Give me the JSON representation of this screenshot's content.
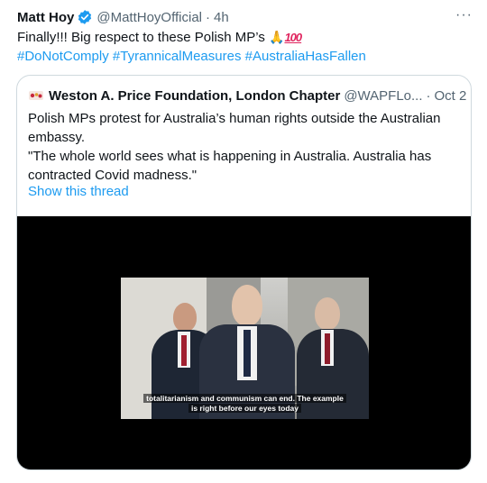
{
  "tweet": {
    "author_name": "Matt Hoy",
    "handle": "@MattHoyOfficial",
    "separator": "·",
    "time": "4h",
    "more": "···",
    "text": "Finally!!! Big respect to these Polish MP’s",
    "emoji_pray": "🙏",
    "emoji_100": "100",
    "hashtags": [
      "#DoNotComply",
      "#TyrannicalMeasures",
      "#AustraliaHasFallen"
    ]
  },
  "quoted": {
    "author_name": "Weston A. Price Foundation, London Chapter",
    "handle": "@WAPFLo...",
    "separator": "·",
    "time": "Oct 2",
    "lines": [
      "Polish MPs protest for Australia’s human rights outside the Australian",
      "embassy.",
      "\"The whole world sees what is happening in Australia. Australia has",
      "contracted Covid madness.\""
    ],
    "show_thread": "Show this thread",
    "video": {
      "caption_line1": "totalitarianism and communism can end. The example",
      "caption_line2": "is right before our eyes today"
    }
  },
  "colors": {
    "link": "#1d9bf0",
    "verified": "#1d9bf0",
    "secondary_text": "#536471",
    "border": "#cfd9de"
  }
}
